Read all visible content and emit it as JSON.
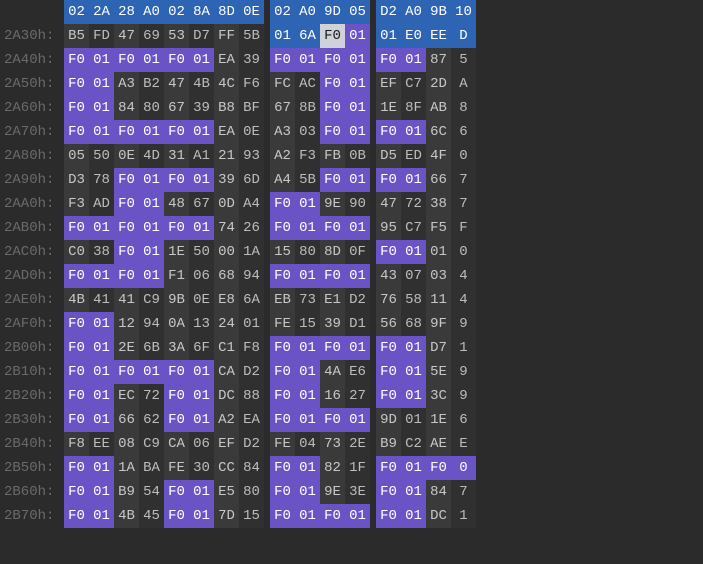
{
  "pattern_value": "F0 01",
  "selected_cell": {
    "row": 1,
    "col": 10
  },
  "rows": [
    {
      "addr": "",
      "cells": [
        "02",
        "2A",
        "28",
        "A0",
        "02",
        "8A",
        "8D",
        "0E",
        "02",
        "A0",
        "9D",
        "05",
        "D2",
        "A0",
        "9B",
        "10"
      ],
      "hl": [],
      "sel": [
        0,
        1,
        2,
        3,
        4,
        5,
        6,
        7,
        8,
        9,
        10,
        11,
        12,
        13,
        14,
        15
      ]
    },
    {
      "addr": "2A30h:",
      "cells": [
        "B5",
        "FD",
        "47",
        "69",
        "53",
        "D7",
        "FF",
        "5B",
        "01",
        "6A",
        "F0",
        "01",
        "01",
        "E0",
        "EE",
        "D"
      ],
      "hl": [
        [
          10,
          11
        ]
      ],
      "sel": [
        8,
        9,
        12,
        13,
        14,
        15
      ]
    },
    {
      "addr": "2A40h:",
      "cells": [
        "F0",
        "01",
        "F0",
        "01",
        "F0",
        "01",
        "EA",
        "39",
        "F0",
        "01",
        "F0",
        "01",
        "F0",
        "01",
        "87",
        "5"
      ],
      "hl": [
        [
          0,
          1
        ],
        [
          2,
          3
        ],
        [
          4,
          5
        ],
        [
          8,
          9
        ],
        [
          10,
          11
        ],
        [
          12,
          13
        ]
      ],
      "sel": []
    },
    {
      "addr": "2A50h:",
      "cells": [
        "F0",
        "01",
        "A3",
        "B2",
        "47",
        "4B",
        "4C",
        "F6",
        "FC",
        "AC",
        "F0",
        "01",
        "EF",
        "C7",
        "2D",
        "A"
      ],
      "hl": [
        [
          0,
          1
        ],
        [
          10,
          11
        ]
      ],
      "sel": []
    },
    {
      "addr": "2A60h:",
      "cells": [
        "F0",
        "01",
        "84",
        "80",
        "67",
        "39",
        "B8",
        "BF",
        "67",
        "8B",
        "F0",
        "01",
        "1E",
        "8F",
        "AB",
        "8"
      ],
      "hl": [
        [
          0,
          1
        ],
        [
          10,
          11
        ]
      ],
      "sel": []
    },
    {
      "addr": "2A70h:",
      "cells": [
        "F0",
        "01",
        "F0",
        "01",
        "F0",
        "01",
        "EA",
        "0E",
        "A3",
        "03",
        "F0",
        "01",
        "F0",
        "01",
        "6C",
        "6"
      ],
      "hl": [
        [
          0,
          1
        ],
        [
          2,
          3
        ],
        [
          4,
          5
        ],
        [
          10,
          11
        ],
        [
          12,
          13
        ]
      ],
      "sel": []
    },
    {
      "addr": "2A80h:",
      "cells": [
        "05",
        "50",
        "0E",
        "4D",
        "31",
        "A1",
        "21",
        "93",
        "A2",
        "F3",
        "FB",
        "0B",
        "D5",
        "ED",
        "4F",
        "0"
      ],
      "hl": [],
      "sel": []
    },
    {
      "addr": "2A90h:",
      "cells": [
        "D3",
        "78",
        "F0",
        "01",
        "F0",
        "01",
        "39",
        "6D",
        "A4",
        "5B",
        "F0",
        "01",
        "F0",
        "01",
        "66",
        "7"
      ],
      "hl": [
        [
          2,
          3
        ],
        [
          4,
          5
        ],
        [
          10,
          11
        ],
        [
          12,
          13
        ]
      ],
      "sel": []
    },
    {
      "addr": "2AA0h:",
      "cells": [
        "F3",
        "AD",
        "F0",
        "01",
        "48",
        "67",
        "0D",
        "A4",
        "F0",
        "01",
        "9E",
        "90",
        "47",
        "72",
        "38",
        "7"
      ],
      "hl": [
        [
          2,
          3
        ],
        [
          8,
          9
        ]
      ],
      "sel": []
    },
    {
      "addr": "2AB0h:",
      "cells": [
        "F0",
        "01",
        "F0",
        "01",
        "F0",
        "01",
        "74",
        "26",
        "F0",
        "01",
        "F0",
        "01",
        "95",
        "C7",
        "F5",
        "F"
      ],
      "hl": [
        [
          0,
          1
        ],
        [
          2,
          3
        ],
        [
          4,
          5
        ],
        [
          8,
          9
        ],
        [
          10,
          11
        ]
      ],
      "sel": []
    },
    {
      "addr": "2AC0h:",
      "cells": [
        "C0",
        "38",
        "F0",
        "01",
        "1E",
        "50",
        "00",
        "1A",
        "15",
        "80",
        "8D",
        "0F",
        "F0",
        "01",
        "01",
        "0"
      ],
      "hl": [
        [
          2,
          3
        ],
        [
          12,
          13
        ]
      ],
      "sel": []
    },
    {
      "addr": "2AD0h:",
      "cells": [
        "F0",
        "01",
        "F0",
        "01",
        "F1",
        "06",
        "68",
        "94",
        "F0",
        "01",
        "F0",
        "01",
        "43",
        "07",
        "03",
        "4"
      ],
      "hl": [
        [
          0,
          1
        ],
        [
          2,
          3
        ],
        [
          8,
          9
        ],
        [
          10,
          11
        ]
      ],
      "sel": []
    },
    {
      "addr": "2AE0h:",
      "cells": [
        "4B",
        "41",
        "41",
        "C9",
        "9B",
        "0E",
        "E8",
        "6A",
        "EB",
        "73",
        "E1",
        "D2",
        "76",
        "58",
        "11",
        "4"
      ],
      "hl": [],
      "sel": []
    },
    {
      "addr": "2AF0h:",
      "cells": [
        "F0",
        "01",
        "12",
        "94",
        "0A",
        "13",
        "24",
        "01",
        "FE",
        "15",
        "39",
        "D1",
        "56",
        "68",
        "9F",
        "9"
      ],
      "hl": [
        [
          0,
          1
        ]
      ],
      "sel": []
    },
    {
      "addr": "2B00h:",
      "cells": [
        "F0",
        "01",
        "2E",
        "6B",
        "3A",
        "6F",
        "C1",
        "F8",
        "F0",
        "01",
        "F0",
        "01",
        "F0",
        "01",
        "D7",
        "1"
      ],
      "hl": [
        [
          0,
          1
        ],
        [
          8,
          9
        ],
        [
          10,
          11
        ],
        [
          12,
          13
        ]
      ],
      "sel": []
    },
    {
      "addr": "2B10h:",
      "cells": [
        "F0",
        "01",
        "F0",
        "01",
        "F0",
        "01",
        "CA",
        "D2",
        "F0",
        "01",
        "4A",
        "E6",
        "F0",
        "01",
        "5E",
        "9"
      ],
      "hl": [
        [
          0,
          1
        ],
        [
          2,
          3
        ],
        [
          4,
          5
        ],
        [
          8,
          9
        ],
        [
          12,
          13
        ]
      ],
      "sel": []
    },
    {
      "addr": "2B20h:",
      "cells": [
        "F0",
        "01",
        "EC",
        "72",
        "F0",
        "01",
        "DC",
        "88",
        "F0",
        "01",
        "16",
        "27",
        "F0",
        "01",
        "3C",
        "9"
      ],
      "hl": [
        [
          0,
          1
        ],
        [
          4,
          5
        ],
        [
          8,
          9
        ],
        [
          12,
          13
        ]
      ],
      "sel": []
    },
    {
      "addr": "2B30h:",
      "cells": [
        "F0",
        "01",
        "66",
        "62",
        "F0",
        "01",
        "A2",
        "EA",
        "F0",
        "01",
        "F0",
        "01",
        "9D",
        "01",
        "1E",
        "6"
      ],
      "hl": [
        [
          0,
          1
        ],
        [
          4,
          5
        ],
        [
          8,
          9
        ],
        [
          10,
          11
        ]
      ],
      "sel": []
    },
    {
      "addr": "2B40h:",
      "cells": [
        "F8",
        "EE",
        "08",
        "C9",
        "CA",
        "06",
        "EF",
        "D2",
        "FE",
        "04",
        "73",
        "2E",
        "B9",
        "C2",
        "AE",
        "E"
      ],
      "hl": [],
      "sel": []
    },
    {
      "addr": "2B50h:",
      "cells": [
        "F0",
        "01",
        "1A",
        "BA",
        "FE",
        "30",
        "CC",
        "84",
        "F0",
        "01",
        "82",
        "1F",
        "F0",
        "01",
        "F0",
        "0"
      ],
      "hl": [
        [
          0,
          1
        ],
        [
          8,
          9
        ],
        [
          12,
          13
        ],
        [
          14,
          15
        ]
      ],
      "sel": []
    },
    {
      "addr": "2B60h:",
      "cells": [
        "F0",
        "01",
        "B9",
        "54",
        "F0",
        "01",
        "E5",
        "80",
        "F0",
        "01",
        "9E",
        "3E",
        "F0",
        "01",
        "84",
        "7"
      ],
      "hl": [
        [
          0,
          1
        ],
        [
          4,
          5
        ],
        [
          8,
          9
        ],
        [
          12,
          13
        ]
      ],
      "sel": []
    },
    {
      "addr": "2B70h:",
      "cells": [
        "F0",
        "01",
        "4B",
        "45",
        "F0",
        "01",
        "7D",
        "15",
        "F0",
        "01",
        "F0",
        "01",
        "F0",
        "01",
        "DC",
        "1"
      ],
      "hl": [
        [
          0,
          1
        ],
        [
          4,
          5
        ],
        [
          8,
          9
        ],
        [
          10,
          11
        ],
        [
          12,
          13
        ]
      ],
      "sel": []
    }
  ]
}
